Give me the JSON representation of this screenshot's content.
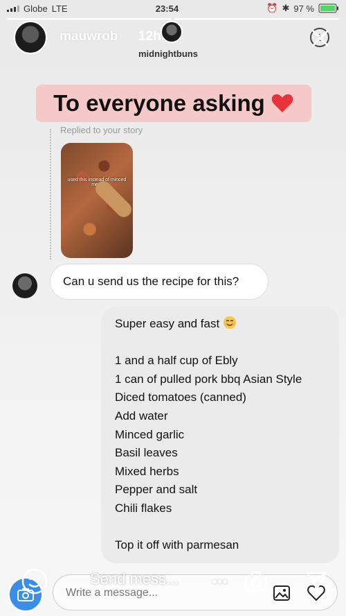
{
  "status_bar": {
    "carrier": "Globe",
    "network": "LTE",
    "time": "23:54",
    "battery": "97 %"
  },
  "story_header": {
    "username": "mauwrob",
    "time_ago": "12h",
    "recipient": "midnightbuns"
  },
  "banner": {
    "text": "To everyone asking"
  },
  "reply": {
    "label": "Replied to your story",
    "thumbnail_caption": "used this instead of minced meat"
  },
  "messages": {
    "incoming": "Can u send us the recipe for this?",
    "outgoing_lines": [
      "Super easy and fast",
      "",
      "1 and a half cup of Ebly",
      "1 can of pulled pork bbq Asian Style",
      "Diced tomatoes (canned)",
      "Add water",
      "Minced garlic",
      "Basil leaves",
      "Mixed herbs",
      "Pepper and salt",
      "Chili flakes",
      "",
      "Top it off with parmesan"
    ]
  },
  "composer": {
    "placeholder": "Write a message...",
    "overlay_text": "Send mess...",
    "dots": "•••"
  },
  "colors": {
    "banner_bg": "#f6c9c9",
    "camera_button": "#3b8ee8",
    "outgoing_bubble": "#ebebeb",
    "heart": "#e8323c"
  }
}
